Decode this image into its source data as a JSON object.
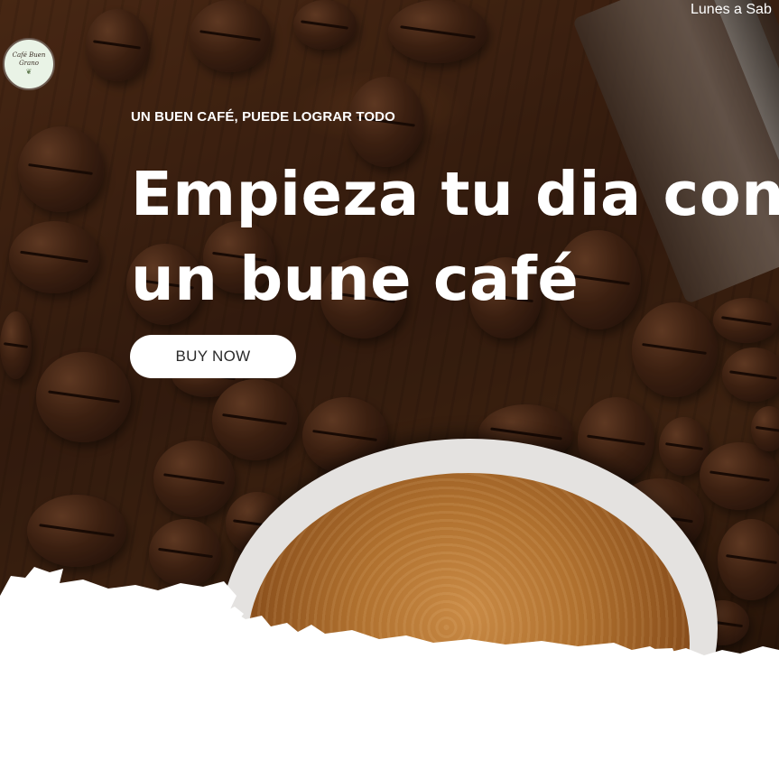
{
  "header": {
    "logo_text": "Café Buen Grano",
    "logo_icon": "coffee-leaf-icon",
    "hours_text": "Lunes a Sab"
  },
  "hero": {
    "kicker": "UN BUEN CAFÉ, PUEDE LOGRAR TODO",
    "headline_line1": "Empieza tu dia con",
    "headline_line2": "un bune café",
    "cta_label": "BUY NOW"
  },
  "colors": {
    "accent": "#ffffff",
    "background_dark": "#3c2011",
    "cta_text": "#2a2a2a"
  }
}
